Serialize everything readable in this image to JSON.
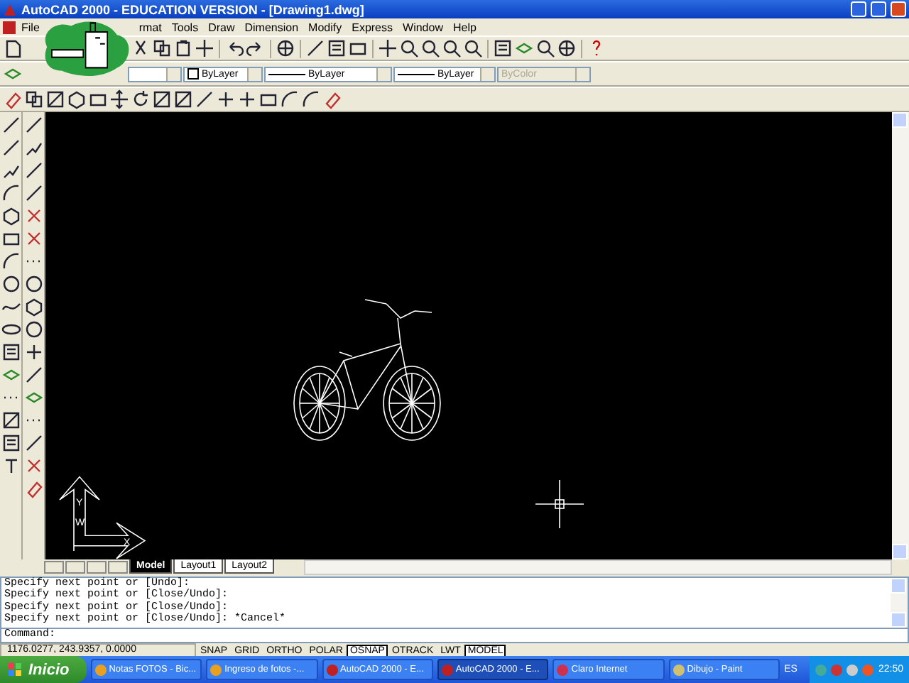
{
  "window": {
    "title": "AutoCAD 2000 - EDUCATION VERSION - [Drawing1.dwg]"
  },
  "menu": [
    {
      "label": "File"
    },
    {
      "label": "rmat"
    },
    {
      "label": "Tools"
    },
    {
      "label": "Draw"
    },
    {
      "label": "Dimension"
    },
    {
      "label": "Modify"
    },
    {
      "label": "Express"
    },
    {
      "label": "Window"
    },
    {
      "label": "Help"
    }
  ],
  "properties": [
    {
      "kind": "color",
      "value": "ByLayer",
      "disabled": false
    },
    {
      "kind": "linetype",
      "value": "ByLayer",
      "disabled": false
    },
    {
      "kind": "lineweight",
      "value": "ByLayer",
      "disabled": false
    },
    {
      "kind": "plotstyle",
      "value": "ByColor",
      "disabled": true
    }
  ],
  "ucs": {
    "y": "Y",
    "w": "W",
    "x": "X"
  },
  "layout_tabs": [
    {
      "label": "Model",
      "selected": true
    },
    {
      "label": "Layout1",
      "selected": false
    },
    {
      "label": "Layout2",
      "selected": false
    }
  ],
  "command_history": [
    "Specify next point or [Undo]:",
    "Specify next point or [Close/Undo]:",
    "Specify next point or [Close/Undo]:",
    "Specify next point or [Close/Undo]: *Cancel*"
  ],
  "command_prompt": "Command:",
  "status_bar": {
    "coordinates": "1176.0277, 243.9357, 0.0000",
    "toggles": [
      {
        "label": "SNAP",
        "on": false
      },
      {
        "label": "GRID",
        "on": false
      },
      {
        "label": "ORTHO",
        "on": false
      },
      {
        "label": "POLAR",
        "on": false
      },
      {
        "label": "OSNAP",
        "on": true
      },
      {
        "label": "OTRACK",
        "on": false
      },
      {
        "label": "LWT",
        "on": false
      },
      {
        "label": "MODEL",
        "on": true
      }
    ]
  },
  "taskbar": {
    "start": "Inicio",
    "tasks": [
      {
        "label": "Notas FOTOS - Bic...",
        "kind": "browser",
        "selected": false
      },
      {
        "label": "Ingreso de fotos -...",
        "kind": "browser",
        "selected": false
      },
      {
        "label": "AutoCAD 2000 - E...",
        "kind": "cad",
        "selected": false
      },
      {
        "label": "AutoCAD 2000 - E...",
        "kind": "cad",
        "selected": true
      },
      {
        "label": "Claro Internet",
        "kind": "dialer",
        "selected": false
      },
      {
        "label": "Dibujo - Paint",
        "kind": "paint",
        "selected": false
      }
    ],
    "language": "ES",
    "clock": "22:50"
  }
}
